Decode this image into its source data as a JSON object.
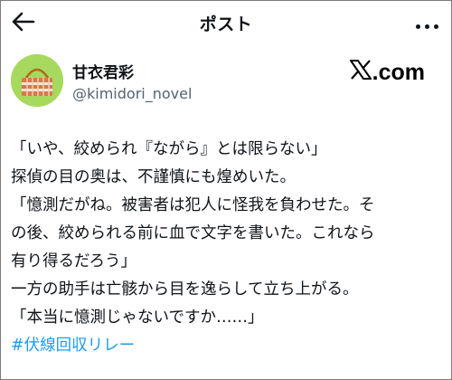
{
  "header": {
    "title": "ポスト"
  },
  "author": {
    "display_name": "甘衣君彩",
    "handle": "@kimidori_novel",
    "avatar_icon": "basket-avatar-icon",
    "avatar_color": "#a6d95d"
  },
  "brand": {
    "text": ".com"
  },
  "post": {
    "lines": [
      "「いや、絞められ『ながら』とは限らない」",
      "探偵の目の奥は、不謹慎にも煌めいた。",
      "「憶測だがね。被害者は犯人に怪我を負わせた。そ",
      "の後、絞められる前に血で文字を書いた。これなら",
      "有り得るだろう」",
      "一方の助手は亡骸から目を逸らして立ち上がる。",
      "「本当に憶測じゃないですか……」"
    ],
    "hashtag": "#伏線回収リレー"
  },
  "colors": {
    "link": "#1d9bf0",
    "text": "#0f1419",
    "secondary_text": "#536471"
  }
}
